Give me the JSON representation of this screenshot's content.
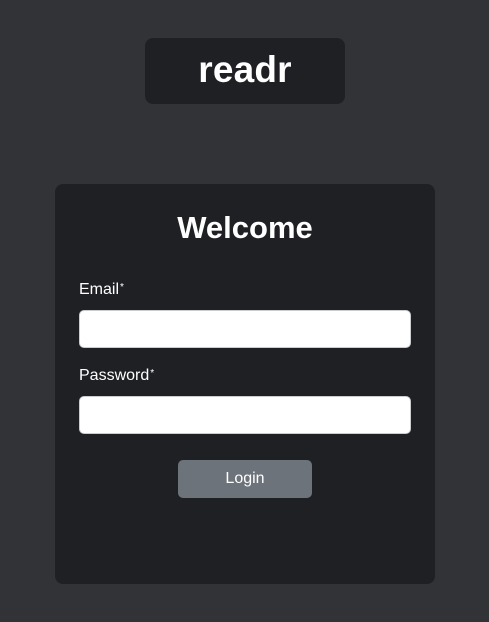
{
  "app": {
    "logo": "readr"
  },
  "login_form": {
    "title": "Welcome",
    "email_label": "Email",
    "email_required_mark": "*",
    "email_value": "",
    "password_label": "Password",
    "password_required_mark": "*",
    "password_value": "",
    "login_label": "Login"
  },
  "colors": {
    "page_background": "#323337",
    "card_background": "#1f2024",
    "button_background": "#6c737b",
    "text": "#ffffff"
  }
}
